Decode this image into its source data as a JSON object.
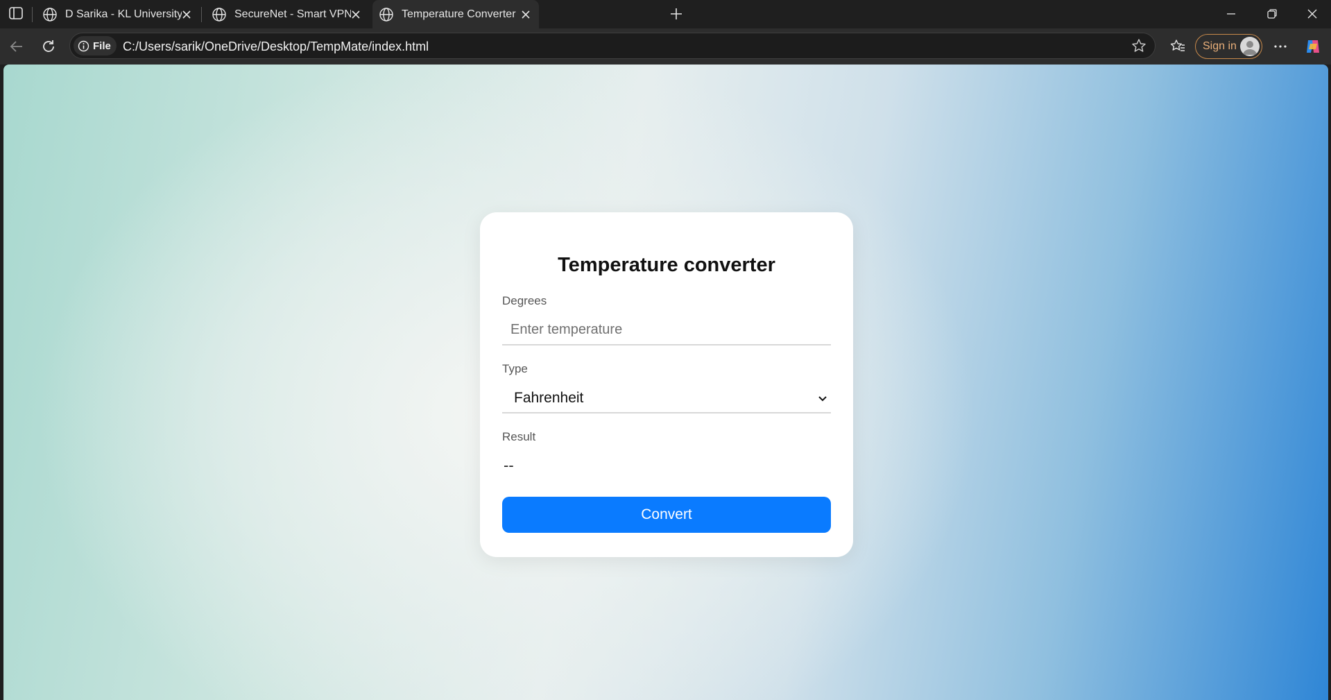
{
  "browser": {
    "tabs": [
      {
        "title": "D Sarika - KL University Portfolio",
        "active": false,
        "icon": "globe-icon"
      },
      {
        "title": "SecureNet - Smart VPN",
        "active": false,
        "icon": "globe-icon"
      },
      {
        "title": "Temperature Converter",
        "active": true,
        "icon": "globe-icon"
      }
    ],
    "address_bar": {
      "scheme_label": "File",
      "url": "C:/Users/sarik/OneDrive/Desktop/TempMate/index.html"
    },
    "sign_in_label": "Sign in"
  },
  "page": {
    "title": "Temperature converter",
    "degrees": {
      "label": "Degrees",
      "placeholder": "Enter temperature",
      "value": ""
    },
    "type": {
      "label": "Type",
      "selected": "Fahrenheit"
    },
    "result": {
      "label": "Result",
      "value": "--"
    },
    "convert_button": "Convert"
  },
  "colors": {
    "button": "#0a7bff",
    "card": "#ffffff",
    "signin_border": "#c98a4b"
  }
}
